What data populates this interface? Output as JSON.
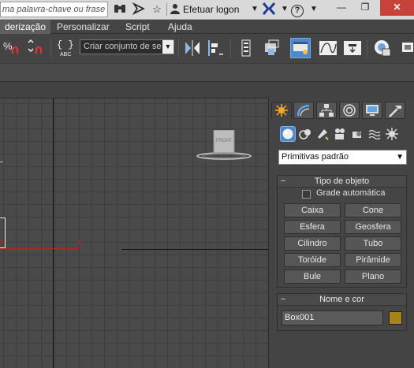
{
  "titlebar": {
    "search_placeholder": "ma palavra-chave ou frase",
    "logon_label": "Efetuar logon",
    "help_label": "?"
  },
  "menu": {
    "items": [
      "derização",
      "Personalizar",
      "Script",
      "Ajuda"
    ],
    "active_index": 0
  },
  "toolbar": {
    "selection_set_placeholder": "Criar conjunto de se",
    "text_tool_label": "ABC"
  },
  "viewport": {
    "cube_label": "FRONT",
    "axis_x_label": "x"
  },
  "command_panel": {
    "category_dropdown": "Primitivas padrão",
    "object_type": {
      "title": "Tipo de objeto",
      "autogrid_label": "Grade automática",
      "autogrid_checked": false,
      "buttons": [
        "Caixa",
        "Cone",
        "Esfera",
        "Geosfera",
        "Cilindro",
        "Tubo",
        "Toróide",
        "Pirâmide",
        "Bule",
        "Plano"
      ]
    },
    "name_color": {
      "title": "Nome e cor",
      "name_value": "Box001",
      "color": "#a7841a"
    }
  },
  "colors": {
    "accent": "#4f87c7",
    "close_button": "#c7423a",
    "x_axis": "#c02020"
  }
}
